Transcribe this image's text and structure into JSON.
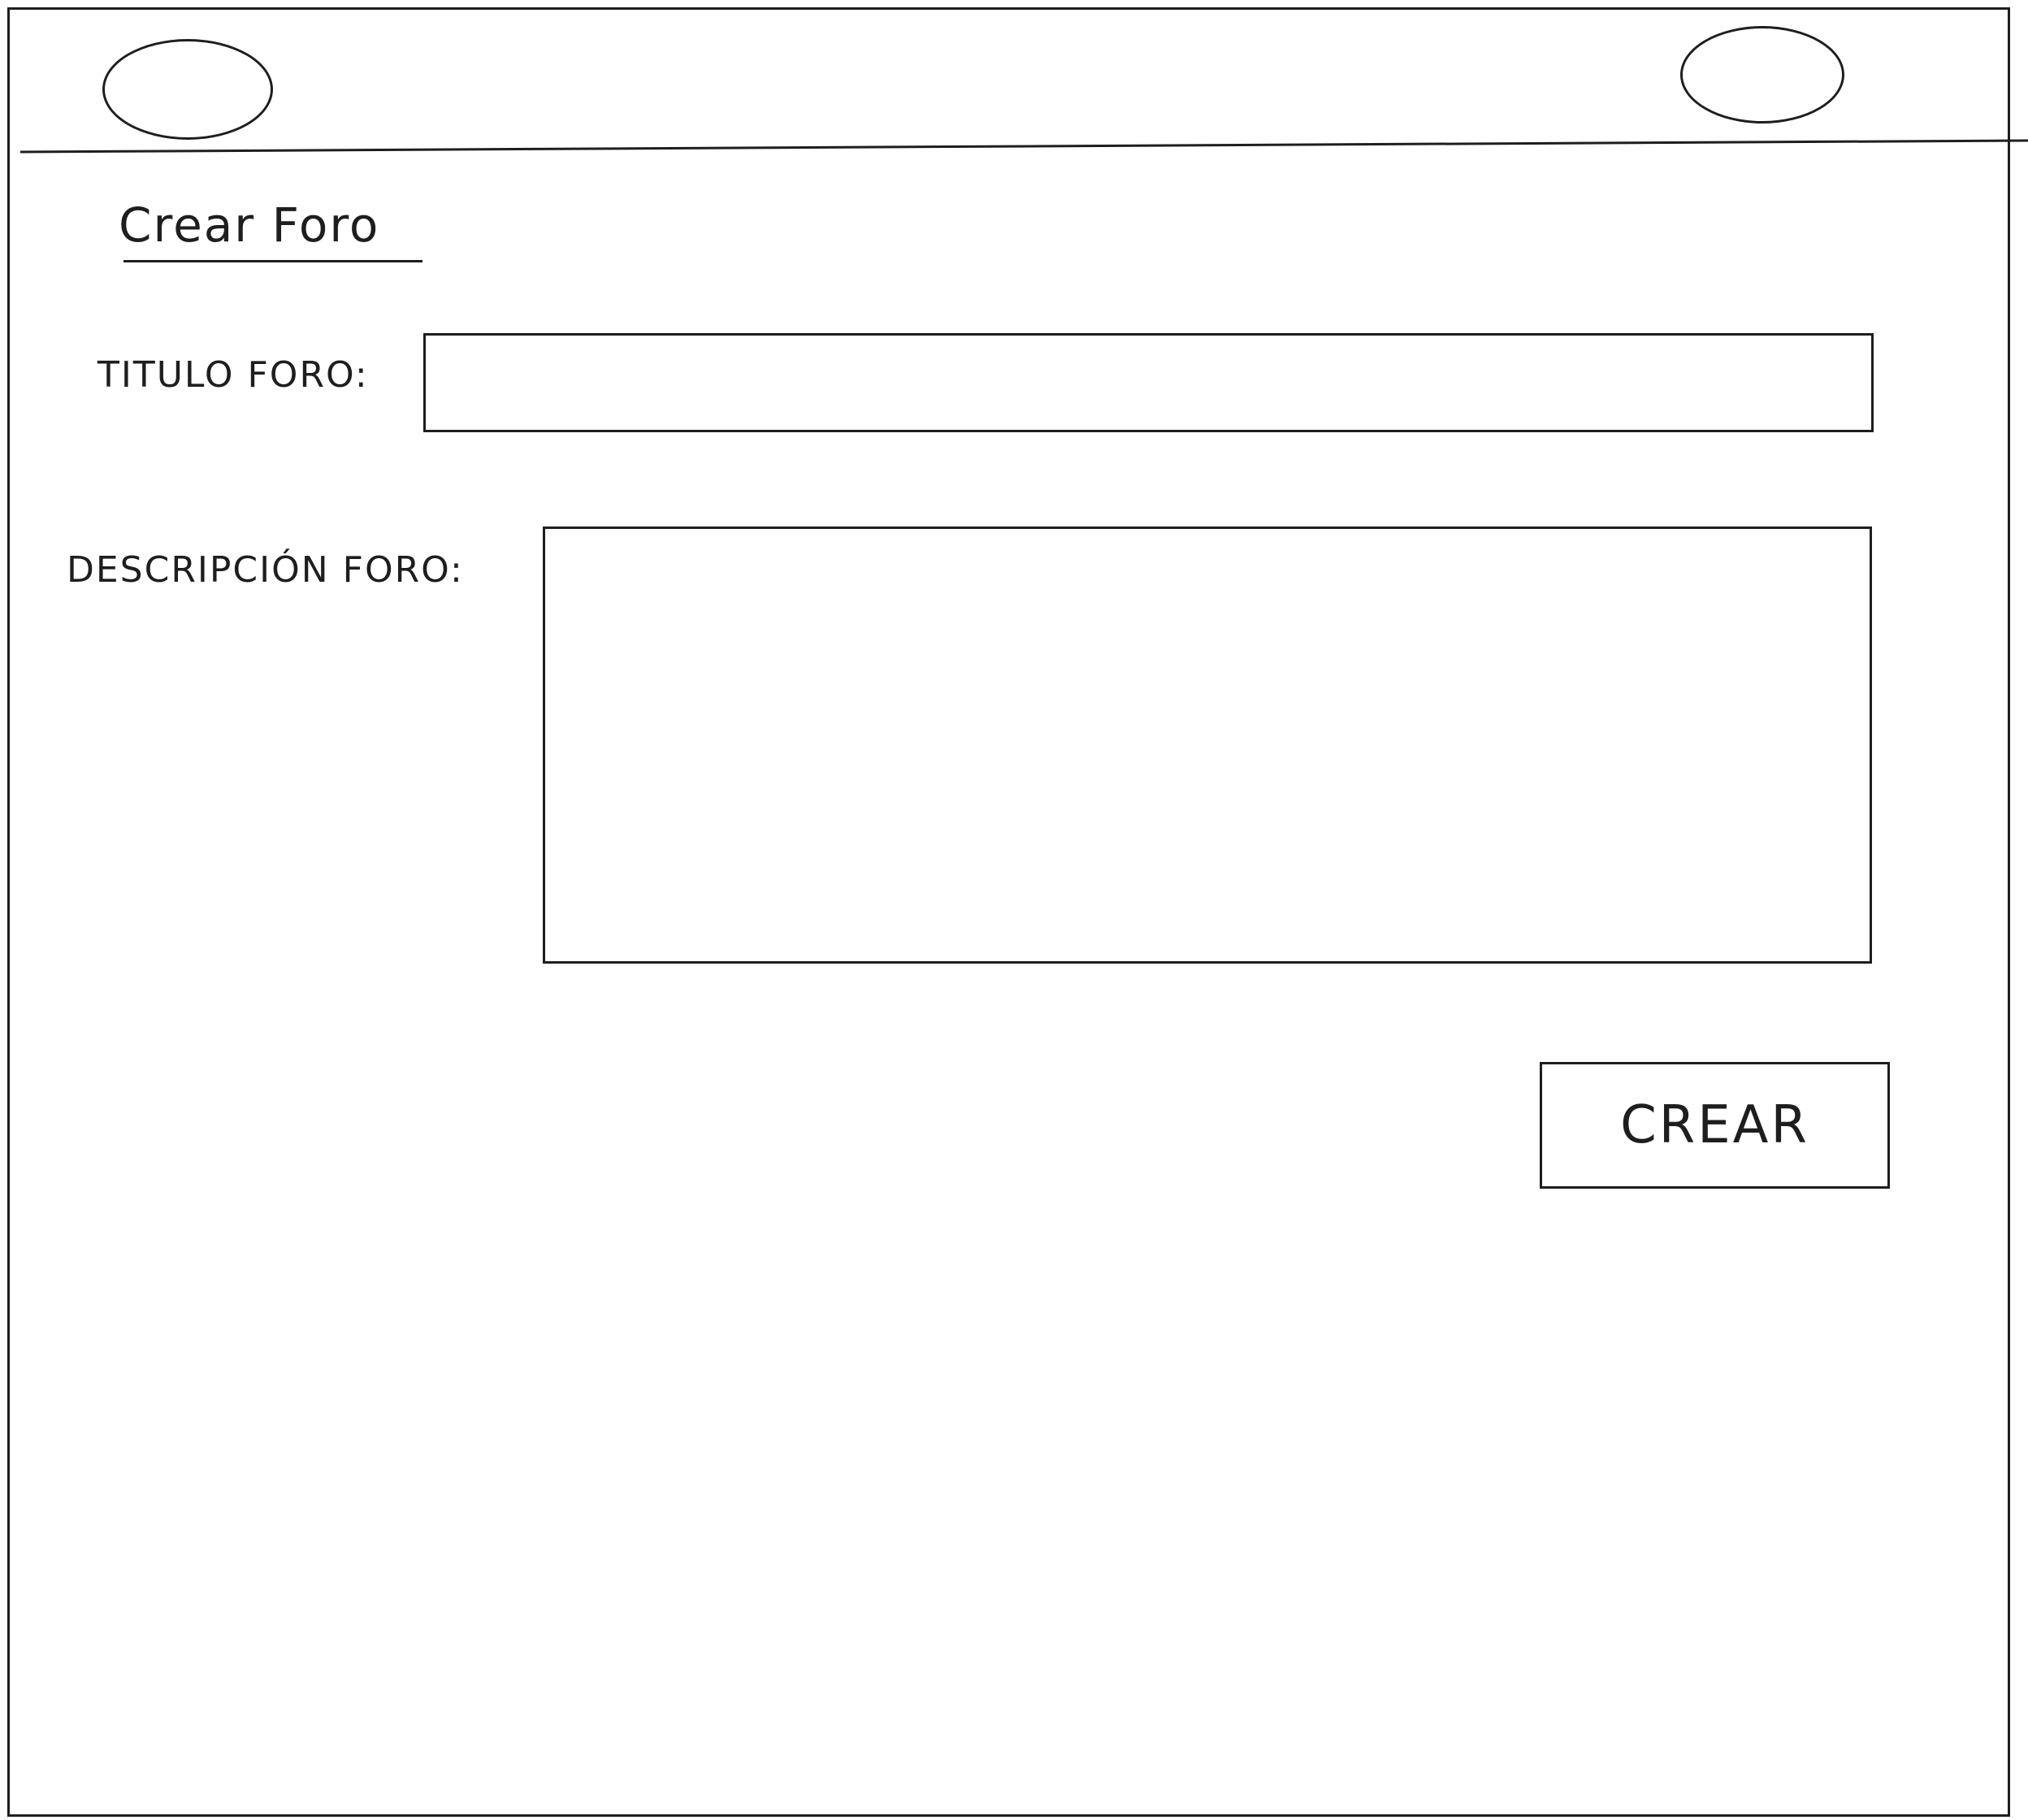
{
  "header": {
    "left_shape": "ellipse-placeholder",
    "right_shape": "ellipse-placeholder"
  },
  "page": {
    "title": "Crear Foro"
  },
  "form": {
    "title_label": "TITULO FORO:",
    "title_value": "",
    "description_label": "DESCRIPCIÓN FORO:",
    "description_value": "",
    "submit_label": "CREAR"
  },
  "colors": {
    "stroke": "#1e1e1e",
    "background": "#ffffff"
  }
}
